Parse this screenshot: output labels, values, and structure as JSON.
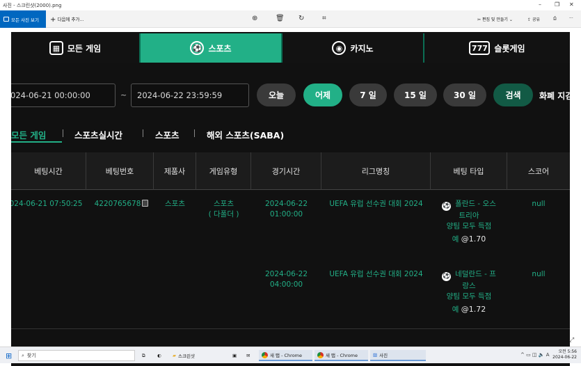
{
  "window": {
    "title": "사진 - 스크린샷(2000).png",
    "controls": [
      "–",
      "❐",
      "✕"
    ]
  },
  "toolbar": {
    "all_photos_label": "모든 사진 보기",
    "add_label": "다음에 추가...",
    "add_icon": "plus-icon",
    "edit_label": "편집 및 만들기",
    "share_label": "공유",
    "more_label": "···"
  },
  "site": {
    "nav_tabs": [
      {
        "label": "모든 게임",
        "icon": "grid-icon"
      },
      {
        "label": "스포츠",
        "icon": "soccer-ball-icon",
        "active": true
      },
      {
        "label": "카지노",
        "icon": "chip-icon"
      },
      {
        "label": "슬롯게임",
        "icon": "slot-machine-icon"
      }
    ],
    "filters": {
      "start_datetime": "024-06-21 00:00:00",
      "separator": "~",
      "end_datetime": "2024-06-22 23:59:59",
      "buttons": [
        {
          "label": "오늘"
        },
        {
          "label": "어제",
          "active": true
        },
        {
          "label": "7 일"
        },
        {
          "label": "15 일"
        },
        {
          "label": "30 일"
        }
      ],
      "search_label": "검색",
      "currency_label": "화폐 지김"
    },
    "sub_tabs": [
      {
        "label": "모든 게임",
        "active": true
      },
      {
        "label": "스포츠실시간"
      },
      {
        "label": "스포츠"
      },
      {
        "label": "해외 스포츠(SABA)"
      }
    ],
    "table": {
      "headers": [
        "베팅시간",
        "베팅번호",
        "제품사",
        "게임유형",
        "경기시간",
        "리그명칭",
        "베팅 타입",
        "스코어"
      ],
      "row": {
        "bet_time": "024-06-21 07:50:25",
        "bet_number": "4220765678",
        "provider": "스포츠",
        "game_type_line1": "스포츠",
        "game_type_line2": "( 다폴더 )",
        "legs": [
          {
            "match_date": "2024-06-22",
            "match_time": "01:00:00",
            "league": "UEFA 유럽 선수권 대회 2024",
            "match_line1": "폴란드 - 오스",
            "match_line2": "트리아",
            "market_line1": "양팀 모두 득점",
            "selection": "예",
            "odds": "@1.70",
            "score": "null"
          },
          {
            "match_date": "2024-06-22",
            "match_time": "04:00:00",
            "league": "UEFA 유럽 선수권 대회 2024",
            "match_line1": "네덜란드 - 프",
            "match_line2": "랑스",
            "market_line1": "양팀 모두 득점",
            "selection": "예",
            "odds": "@1.72",
            "score": "null"
          }
        ]
      }
    }
  },
  "taskbar": {
    "search_placeholder": "찾기",
    "apps": [
      {
        "label": "스크린샷",
        "icon": "folder-icon"
      },
      {
        "label": "새 탭 - Chrome",
        "icon": "chrome-icon"
      },
      {
        "label": "새 탭 - Chrome",
        "icon": "chrome-icon"
      },
      {
        "label": "사진",
        "icon": "photos-icon"
      }
    ],
    "tray_lang": "A",
    "clock_time": "오전 5:56",
    "clock_date": "2024-06-22"
  },
  "colors": {
    "accent": "#22b087",
    "dark_bg": "#111111",
    "windows_blue": "#0067c0"
  }
}
